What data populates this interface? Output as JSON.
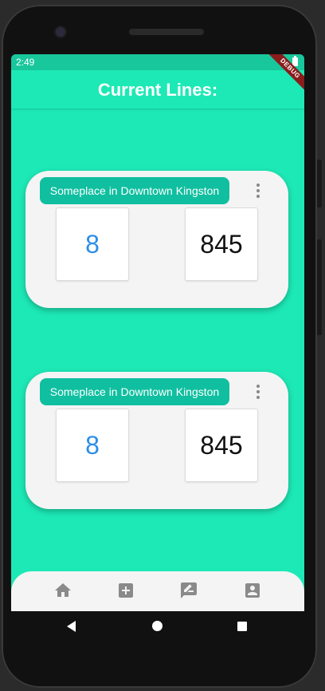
{
  "status_bar": {
    "time": "2:49",
    "debug_label": "DEBUG"
  },
  "app_bar": {
    "title": "Current Lines:"
  },
  "cards": [
    {
      "location": "Someplace in Downtown Kingston",
      "left_value": "8",
      "right_value": "845"
    },
    {
      "location": "Someplace in Downtown Kingston",
      "left_value": "8",
      "right_value": "845"
    }
  ],
  "bottom_nav": {
    "items": [
      {
        "icon": "home-icon"
      },
      {
        "icon": "add-box-icon"
      },
      {
        "icon": "rate-review-icon"
      },
      {
        "icon": "account-box-icon"
      }
    ]
  },
  "colors": {
    "background": "#1de9b6",
    "status_bar": "#19c79c",
    "chip": "#10bfa0",
    "card": "#f4f4f4",
    "left_value": "#2d8ee8",
    "nav_icon": "#8a8a8a"
  }
}
